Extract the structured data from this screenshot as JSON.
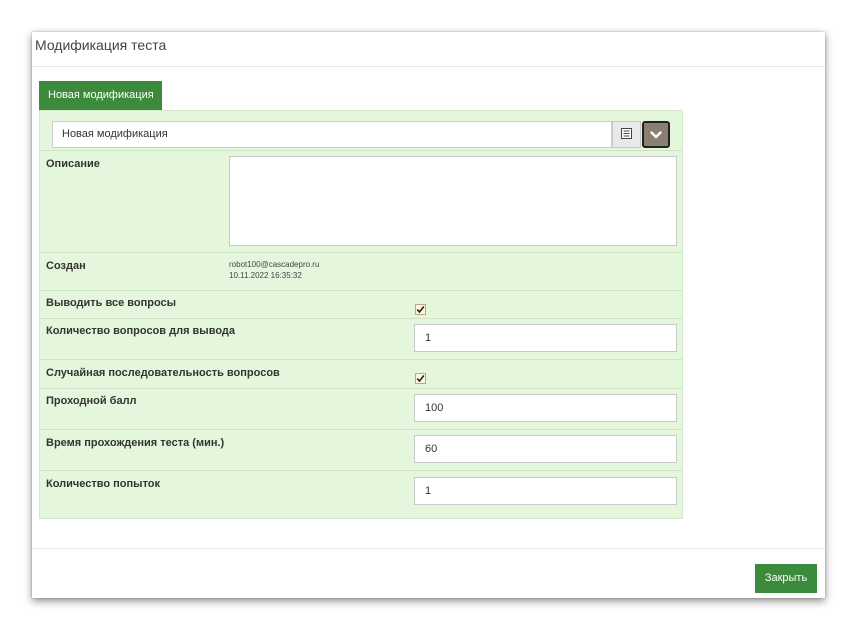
{
  "dialog": {
    "title": "Модификация теста",
    "close_label": "Закрыть"
  },
  "tabs": [
    {
      "label": "Новая модификация",
      "active": true
    }
  ],
  "modification_select": {
    "value": "Новая модификация",
    "list_icon": "list-icon",
    "dropdown_icon": "chevron-down-icon"
  },
  "fields": {
    "description": {
      "label": "Описание",
      "value": ""
    },
    "created": {
      "label": "Создан",
      "author": "robot100@cascadepro.ru",
      "datetime": "10.11.2022 16:35:32"
    },
    "show_all_questions": {
      "label": "Выводить все вопросы",
      "checked": true
    },
    "questions_count": {
      "label": "Количество вопросов для вывода",
      "value": "1"
    },
    "random_order": {
      "label": "Случайная последовательность вопросов",
      "checked": true
    },
    "passing_score": {
      "label": "Проходной балл",
      "value": "100"
    },
    "time_limit": {
      "label": "Время прохождения теста (мин.)",
      "value": "60"
    },
    "attempts": {
      "label": "Количество попыток",
      "value": "1"
    }
  },
  "colors": {
    "accent_green": "#3c8a3c",
    "panel_bg": "#e4f7dc",
    "dropdown_button": "#8b7e72"
  }
}
